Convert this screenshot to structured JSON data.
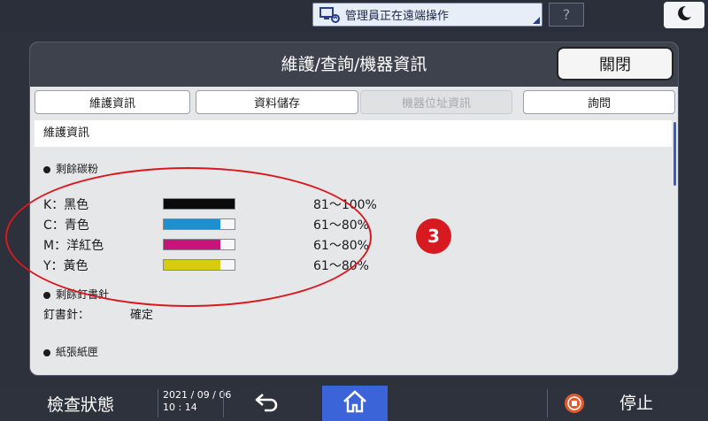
{
  "topbar": {
    "remote_label": "管理員正在遠端操作",
    "help_label": "?"
  },
  "panel": {
    "title": "維護/查詢/機器資訊",
    "close_label": "關閉",
    "tabs": [
      {
        "label": "維護資訊",
        "disabled": false
      },
      {
        "label": "資料儲存",
        "disabled": false
      },
      {
        "label": "機器位址資訊",
        "disabled": true
      },
      {
        "label": "詢問",
        "disabled": false
      }
    ],
    "section_title": "維護資訊"
  },
  "toner": {
    "heading": "剩餘碳粉",
    "rows": [
      {
        "name": "K：黑色",
        "percent": "81～100%",
        "level": 1.0,
        "color": "#0a0a0a"
      },
      {
        "name": "C：青色",
        "percent": "61～80%",
        "level": 0.8,
        "color": "#1e8fd0"
      },
      {
        "name": "M：洋紅色",
        "percent": "61～80%",
        "level": 0.8,
        "color": "#c8137a"
      },
      {
        "name": "Y：黃色",
        "percent": "61～80%",
        "level": 0.8,
        "color": "#d8cc10"
      }
    ]
  },
  "staples": {
    "heading": "剩餘釘書針",
    "label": "釘書針：",
    "value": "確定"
  },
  "paper": {
    "heading": "紙張紙匣"
  },
  "annotation": {
    "badge": "3",
    "color": "#d71920"
  },
  "bottombar": {
    "status_label": "檢查狀態",
    "date": "2021 / 09 / 06",
    "time": "10 : 14",
    "stop_label": "停止"
  }
}
